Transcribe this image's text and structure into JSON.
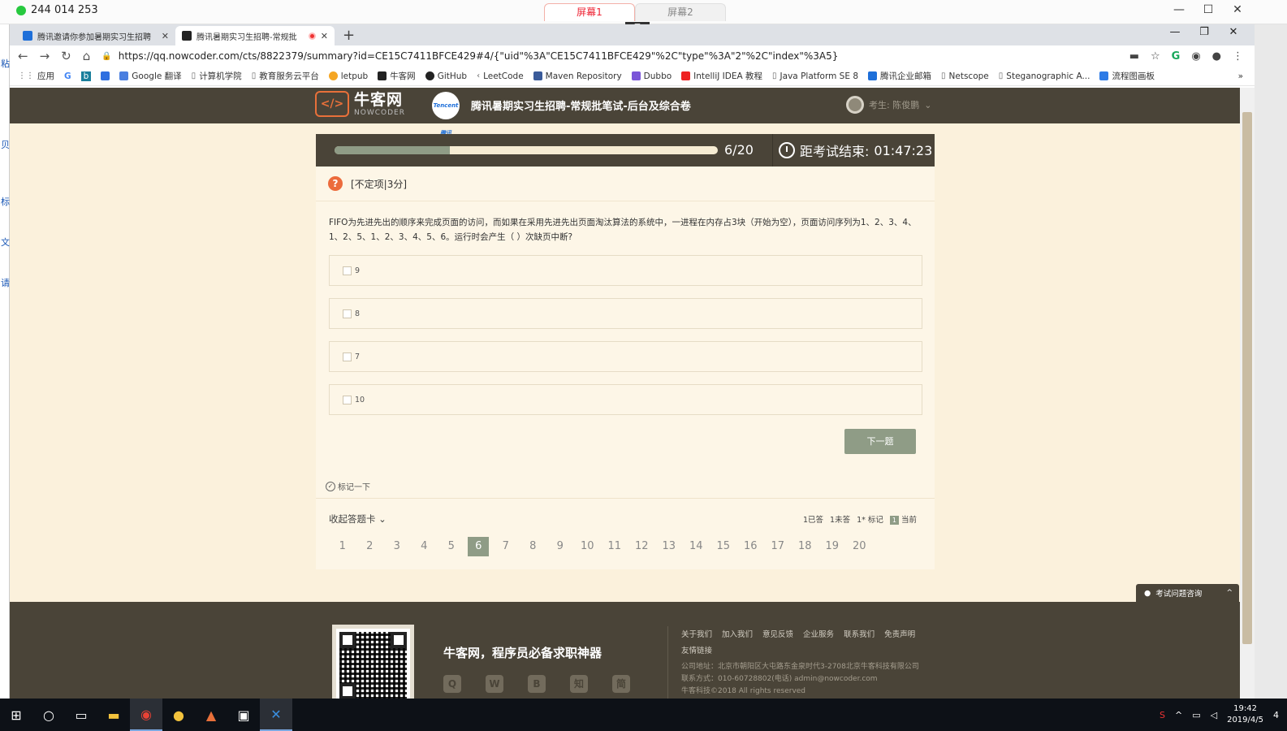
{
  "remote": {
    "session_id": "244 014 253",
    "screen_tabs": [
      "屏幕1",
      "屏幕2"
    ],
    "controls": [
      "—",
      "☐",
      "✕"
    ]
  },
  "browser": {
    "tabs": [
      {
        "title": "腾讯邀请你参加暑期实习生招聘",
        "close": "✕"
      },
      {
        "title": "腾讯暑期实习生招聘-常规批",
        "close": "✕"
      }
    ],
    "new_tab": "+",
    "window_controls": [
      "—",
      "❐",
      "✕"
    ],
    "url": "https://qq.nowcoder.com/cts/8822379/summary?id=CE15C7411BFCE429#4/{\"uid\"%3A\"CE15C7411BFCE429\"%2C\"type\"%3A\"2\"%2C\"index\"%3A5}",
    "bookmarks": [
      "应用",
      "G",
      "b",
      "",
      "Google 翻译",
      "计算机学院",
      "教育服务云平台",
      "letpub",
      "牛客网",
      "GitHub",
      "LeetCode",
      "Maven Repository",
      "Dubbo",
      "IntelliJ IDEA 教程",
      "Java Platform SE 8",
      "腾讯企业邮箱",
      "Netscope",
      "Steganographic A...",
      "流程图画板"
    ],
    "more": "»"
  },
  "site": {
    "logo_cn": "牛客网",
    "logo_en": "NOWCODER",
    "tencent": "Tencent 腾讯",
    "exam_title": "腾讯暑期实习生招聘-常规批笔试-后台及综合卷",
    "user_label": "考生: 陈俊鹏",
    "user_caret": "⌄"
  },
  "exam": {
    "progress_fraction": 0.3,
    "progress_text": "6/20",
    "timer_label": "距考试结束:",
    "timer_value": "01:47:23",
    "question_type": "[不定项|3分]",
    "question_text": "FIFO为先进先出的顺序来完成页面的访问，而如果在采用先进先出页面淘汰算法的系统中，一进程在内存占3块（开始为空），页面访问序列为1、2、3、4、1、2、5、1、2、3、4、5、6。运行时会产生（  ）次缺页中断?",
    "options": [
      "9",
      "8",
      "7",
      "10"
    ],
    "next_button": "下一题",
    "mark_label": "标记一下",
    "collapse_card": "收起答题卡 ⌄",
    "legend": {
      "answered": "1已答",
      "unanswered": "1未答",
      "marked": "1* 标记",
      "current_num": "1",
      "current": "当前"
    },
    "question_numbers": [
      "1",
      "2",
      "3",
      "4",
      "5",
      "6",
      "7",
      "8",
      "9",
      "10",
      "11",
      "12",
      "13",
      "14",
      "15",
      "16",
      "17",
      "18",
      "19",
      "20"
    ],
    "current_index": 6
  },
  "consult": {
    "label": "考试问题咨询",
    "caret": "^"
  },
  "footer": {
    "slogan": "牛客网，程序员必备求职神器",
    "links": [
      "关于我们",
      "加入我们",
      "意见反馈",
      "企业服务",
      "联系我们",
      "免责声明",
      "友情链接"
    ],
    "address": "公司地址：北京市朝阳区大屯路东金泉时代3-2708北京牛客科技有限公司",
    "contact": "联系方式：010-60728802(电话)      admin@nowcoder.com",
    "copyright": "牛客科技©2018 All rights reserved",
    "social": [
      "Q",
      "W",
      "B",
      "知",
      "简"
    ]
  },
  "taskbar": {
    "time": "19:42",
    "date": "2019/4/5",
    "notif": "4"
  }
}
